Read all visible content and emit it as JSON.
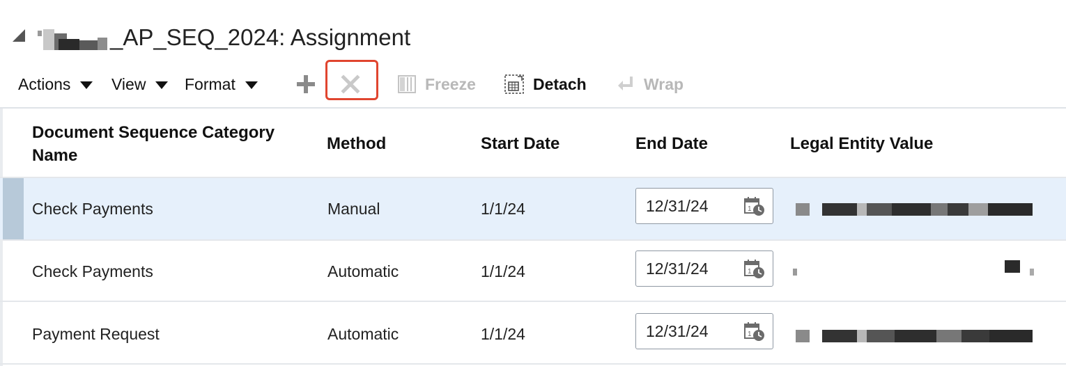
{
  "header": {
    "title": "_AP_SEQ_2024: Assignment"
  },
  "toolbar": {
    "actions_label": "Actions",
    "view_label": "View",
    "format_label": "Format",
    "freeze_label": "Freeze",
    "detach_label": "Detach",
    "wrap_label": "Wrap"
  },
  "table": {
    "columns": {
      "category": "Document Sequence Category Name",
      "method": "Method",
      "start_date": "Start Date",
      "end_date": "End Date",
      "legal_entity": "Legal Entity Value"
    },
    "rows": [
      {
        "category": "Check Payments",
        "method": "Manual",
        "start_date": "1/1/24",
        "end_date": "12/31/24",
        "selected": true
      },
      {
        "category": "Check Payments",
        "method": "Automatic",
        "start_date": "1/1/24",
        "end_date": "12/31/24",
        "selected": false
      },
      {
        "category": "Payment Request",
        "method": "Automatic",
        "start_date": "1/1/24",
        "end_date": "12/31/24",
        "selected": false
      }
    ]
  },
  "icons": {
    "add": "plus-icon",
    "delete": "x-icon",
    "freeze": "freeze-columns-icon",
    "detach": "detach-icon",
    "wrap": "wrap-icon",
    "calendar": "calendar-icon"
  },
  "colors": {
    "highlight": "#e0452f",
    "selected_row": "#e6f0fb"
  }
}
